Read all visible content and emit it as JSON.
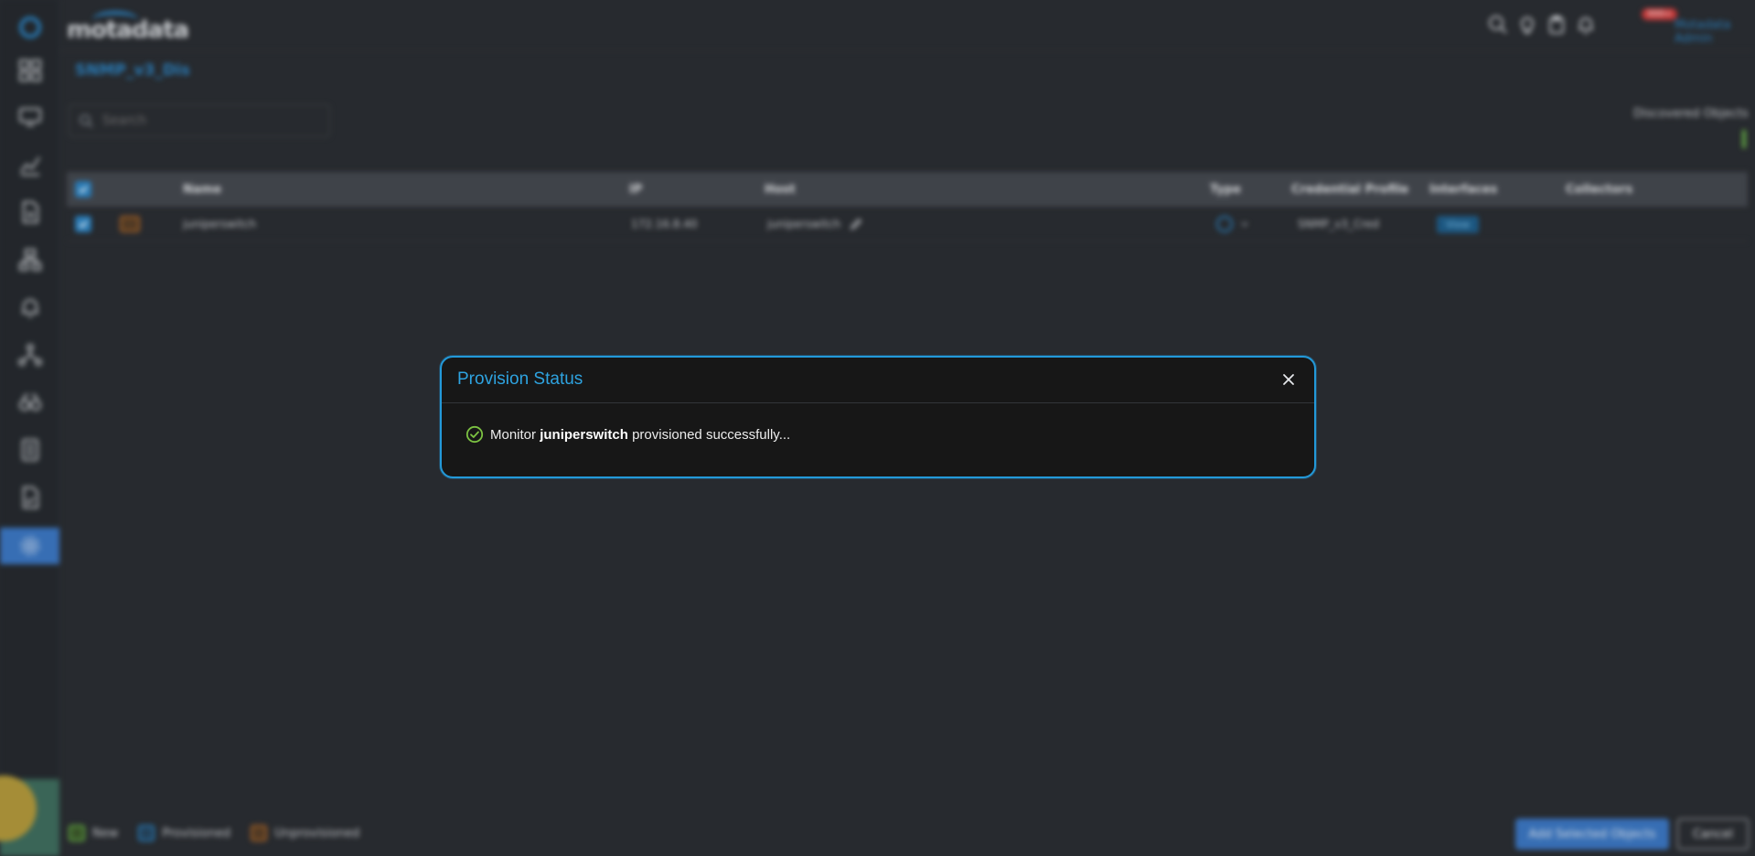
{
  "app": {
    "logo_text": "motadata",
    "page_title": "SNMP_v3_Dis",
    "user_name": "Motadata Admin",
    "notification_count": "999+"
  },
  "search": {
    "placeholder": "Search",
    "value": ""
  },
  "discovered_objects": {
    "label": "Discovered Objects"
  },
  "grid": {
    "columns": [
      "Name",
      "IP",
      "Host",
      "Type",
      "Credential Profile",
      "Interfaces",
      "Collectors"
    ],
    "rows": [
      {
        "name": "juniperswitch",
        "ip": "172.16.8.40",
        "host": "juniperswitch",
        "type_icon": "device-type-icon",
        "credential_profile": "SNMP_v3_Cred",
        "interfaces": "View",
        "collectors": ""
      }
    ]
  },
  "legend": {
    "new": "New",
    "provisioned": "Provisioned",
    "unprovisioned": "Unprovisioned"
  },
  "buttons": {
    "add_selected": "Add Selected Objects",
    "cancel": "Cancel"
  },
  "modal": {
    "title": "Provision Status",
    "message_prefix": "Monitor",
    "message_subject": "juniperswitch",
    "message_suffix": "provisioned successfully..."
  },
  "colors": {
    "accent": "#2399d9",
    "success": "#7cc242",
    "primary_button": "#3c78c4",
    "background": "#2b2e33",
    "modal_background": "#171717"
  },
  "icons": {
    "sidebar": [
      "app-logo-icon",
      "dashboard-icon",
      "monitor-icon",
      "metric-explorer-icon",
      "report-icon",
      "network-topology-icon",
      "alert-icon",
      "hierarchy-icon",
      "binoculars-icon",
      "log-icon",
      "audit-icon",
      "settings-icon"
    ],
    "topbar": [
      "search-icon",
      "lightbulb-icon",
      "clipboard-icon",
      "bell-icon"
    ],
    "modal": [
      "close-icon",
      "check-circle-icon"
    ]
  }
}
